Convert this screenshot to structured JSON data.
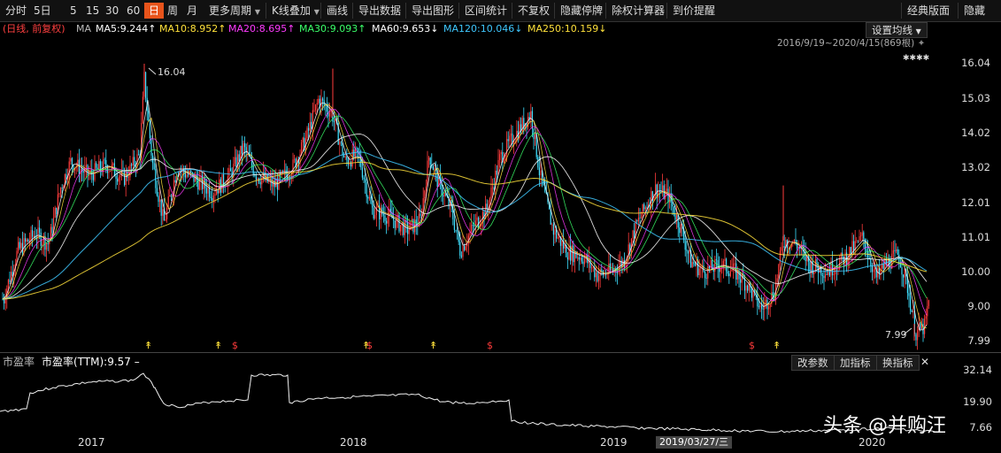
{
  "toolbar": {
    "items": [
      "分时",
      "5日",
      "5",
      "15",
      "30",
      "60",
      "日",
      "周",
      "月",
      "更多周期",
      "K线叠加",
      "画线",
      "导出数据",
      "导出图形",
      "区间统计",
      "不复权",
      "隐藏停牌",
      "除权计算器",
      "到价提醒"
    ],
    "active": "日",
    "right": [
      "经典版面",
      "隐藏"
    ]
  },
  "ma_bar": {
    "mode": "(日线, 前复权)",
    "ma_label": "MA",
    "ma5": "MA5:9.244",
    "ma10": "MA10:8.952",
    "ma20": "MA20:8.695",
    "ma30": "MA30:9.093",
    "ma60": "MA60:9.653",
    "ma120": "MA120:10.046",
    "ma250": "MA250:10.159",
    "arrows": [
      "↑",
      "↑",
      "↑",
      "↑",
      "↓",
      "↓",
      "↓"
    ],
    "settings_button": "设置均线",
    "range_text": "2016/9/19~2020/4/15(869根)"
  },
  "price_axis": [
    "16.04",
    "15.03",
    "14.02",
    "13.02",
    "12.01",
    "11.01",
    "10.00",
    "9.00",
    "7.99"
  ],
  "annotations": {
    "high": "16.04",
    "low": "7.99"
  },
  "pe_panel": {
    "label": "市盈率",
    "value_text": "市盈率(TTM):9.57",
    "dash": "–",
    "buttons": [
      "改参数",
      "加指标",
      "换指标"
    ],
    "close": "✕",
    "axis": [
      "32.14",
      "19.90",
      "7.66"
    ]
  },
  "x_axis": [
    "2017",
    "2018",
    "2019",
    "2020"
  ],
  "crosshair_date": "2019/03/27/三",
  "watermark": "头条 @并购汪",
  "colors": {
    "up": "#ff3b3b",
    "down": "#3fe0ff",
    "ma5": "#ffffff",
    "ma10": "#ffe13b",
    "ma20": "#ff3bff",
    "ma30": "#3bff6a",
    "ma60": "#ffffff",
    "ma120": "#3fc8ff",
    "ma250": "#ffe13b",
    "accent": "#e8541b"
  }
}
